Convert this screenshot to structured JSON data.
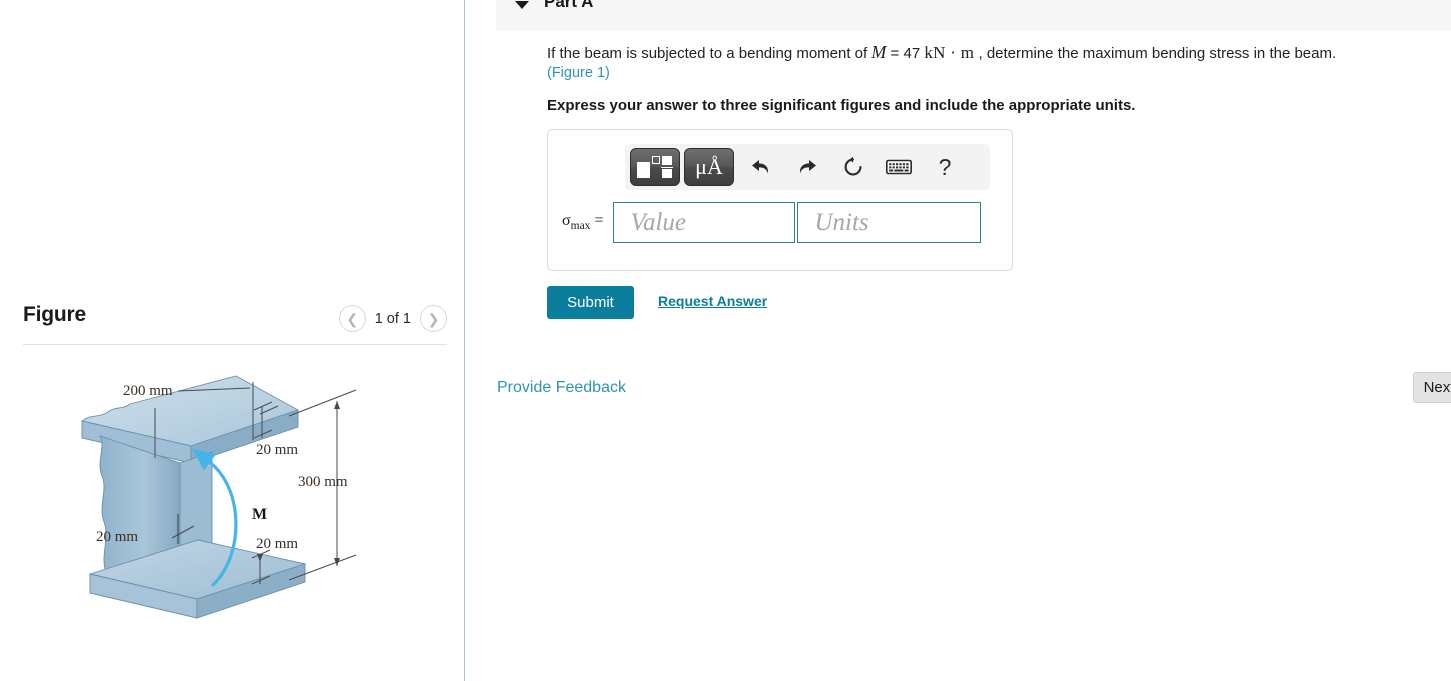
{
  "left_panel": {
    "figure_title": "Figure",
    "nav": {
      "prev_icon": "chevron-left-icon",
      "next_icon": "chevron-right-icon",
      "counter": "1 of 1"
    },
    "figure": {
      "caption_labels": {
        "flange_width": "200 mm",
        "top_flange_thickness": "20 mm",
        "total_height": "300 mm",
        "bottom_flange_thickness": "20 mm",
        "web_thickness": "20 mm",
        "moment": "M"
      },
      "colors": {
        "beam_face_light": "#b9cfe0",
        "beam_face_mid": "#9dbed4",
        "beam_face_dark": "#86aac4",
        "beam_edge": "#5b7f99",
        "moment_arrow": "#45b4e8"
      }
    }
  },
  "right_panel": {
    "part_header": {
      "caret_icon": "chevron-down-icon",
      "title": "Part A"
    },
    "question": {
      "text_before": "If the beam is subjected to a bending moment of",
      "math_symbol": "M",
      "math_equals": "= 47",
      "math_units": "kN · m",
      "text_after": ", determine the maximum bending stress in the beam.",
      "figure_link": "(Figure 1)"
    },
    "instruction": "Express your answer to three significant figures and include the appropriate units.",
    "answer_widget": {
      "toolbar": [
        {
          "name": "math-template-button",
          "icon": "math-template-icon",
          "label": ""
        },
        {
          "name": "units-button",
          "icon": "mu-angstrom-icon",
          "label": "μÅ"
        },
        {
          "name": "undo-button",
          "icon": "undo-arrow-icon",
          "label": ""
        },
        {
          "name": "redo-button",
          "icon": "redo-arrow-icon",
          "label": ""
        },
        {
          "name": "reset-button",
          "icon": "reset-circular-arrow-icon",
          "label": ""
        },
        {
          "name": "keyboard-button",
          "icon": "keyboard-icon",
          "label": ""
        },
        {
          "name": "help-button",
          "icon": "question-mark-icon",
          "label": "?"
        }
      ],
      "answer_label_symbol": "σ",
      "answer_label_subscript": "max",
      "answer_label_equals": "=",
      "value_placeholder": "Value",
      "units_placeholder": "Units",
      "value_current": "",
      "units_current": "",
      "field_border_color": "#2f7f92"
    },
    "actions": {
      "submit_label": "Submit",
      "request_answer_label": "Request Answer",
      "provide_feedback_label": "Provide Feedback",
      "next_label": "Next",
      "submit_color": "#0b7e9e",
      "link_color": "#2f93b5"
    }
  }
}
